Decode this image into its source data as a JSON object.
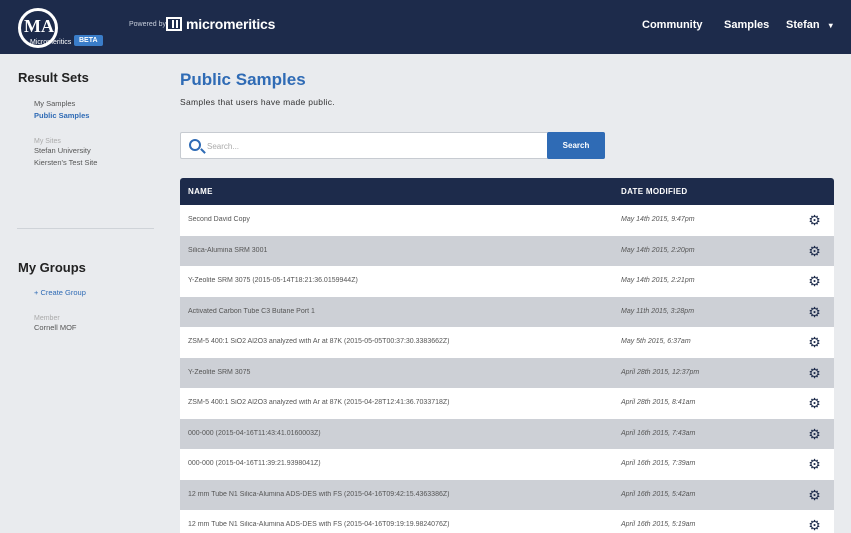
{
  "app": {
    "logo_text": "MA",
    "logo_sub": "Micromeritics",
    "beta_badge": "BETA",
    "powered_by": "Powered by",
    "brand_name": "micromeritics"
  },
  "nav": {
    "community": "Community",
    "samples": "Samples",
    "user": "Stefan",
    "user_caret": "▾"
  },
  "sidebar": {
    "result_sets_title": "Result Sets",
    "result_sets": [
      {
        "label": "My Samples"
      },
      {
        "label": "Public Samples"
      }
    ],
    "my_sites_heading": "My Sites",
    "sites": [
      {
        "label": "Stefan University"
      },
      {
        "label": "Kiersten's Test Site"
      }
    ],
    "groups_title": "My Groups",
    "create_group": "+ Create Group",
    "member_heading": "Member",
    "groups": [
      {
        "label": "Cornell MOF"
      }
    ]
  },
  "main": {
    "title": "Public Samples",
    "subtitle": "Samples that users have made public.",
    "search_placeholder": "Search...",
    "search_button": "Search",
    "columns": {
      "name": "NAME",
      "date": "DATE MODIFIED"
    },
    "rows": [
      {
        "name": "Second David Copy",
        "date": "May 14th 2015, 9:47pm"
      },
      {
        "name": "Silica-Alumina SRM 3001",
        "date": "May 14th 2015, 2:20pm"
      },
      {
        "name": "Y-Zeolite SRM 3075 (2015-05-14T18:21:36.0159944Z)",
        "date": "May 14th 2015, 2:21pm"
      },
      {
        "name": "Activated Carbon Tube C3 Butane Port 1",
        "date": "May 11th 2015, 3:28pm"
      },
      {
        "name": "ZSM-5 400:1 SiO2 Al2O3 analyzed with Ar at 87K (2015-05-05T00:37:30.3383662Z)",
        "date": "May 5th 2015, 6:37am"
      },
      {
        "name": "Y-Zeolite SRM 3075",
        "date": "April 28th 2015, 12:37pm"
      },
      {
        "name": "ZSM-5 400:1 SiO2 Al2O3 analyzed with Ar at 87K (2015-04-28T12:41:36.7033718Z)",
        "date": "April 28th 2015, 8:41am"
      },
      {
        "name": "000-000 (2015-04-16T11:43:41.0160003Z)",
        "date": "April 16th 2015, 7:43am"
      },
      {
        "name": "000-000 (2015-04-16T11:39:21.9398041Z)",
        "date": "April 16th 2015, 7:39am"
      },
      {
        "name": "12 mm Tube N1 Silica-Alumina ADS-DES with FS (2015-04-16T09:42:15.4363386Z)",
        "date": "April 16th 2015, 5:42am"
      },
      {
        "name": "12 mm Tube N1 Silica-Alumina ADS-DES with FS (2015-04-16T09:19:19.9824076Z)",
        "date": "April 16th 2015, 5:19am"
      }
    ]
  },
  "icons": {
    "gear": "gear-icon",
    "search": "search-icon"
  },
  "colors": {
    "navbar": "#1d2b4b",
    "accent": "#2f6bb5",
    "row_alt": "#cdd0d6",
    "background": "#e9ebee"
  }
}
